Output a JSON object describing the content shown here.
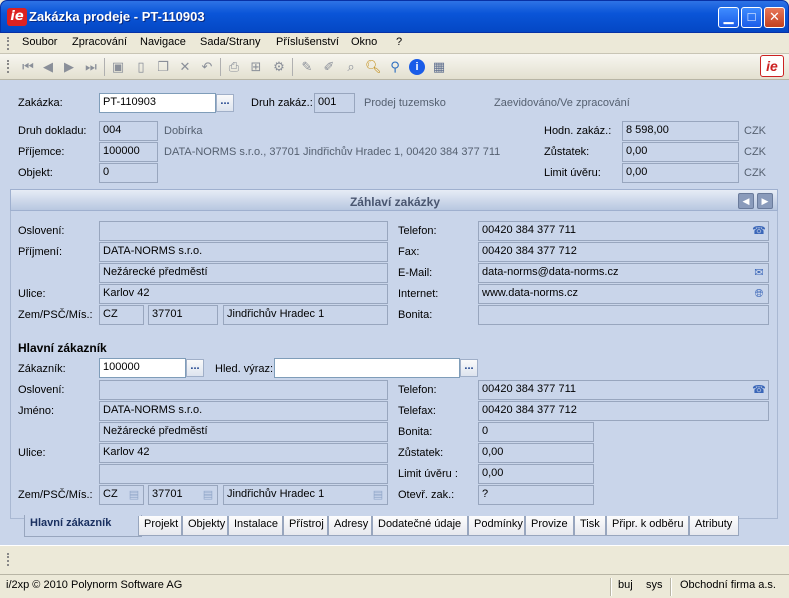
{
  "window": {
    "title": "Zakázka prodeje - PT-110903",
    "icon": "ie-app-icon",
    "buttons": [
      "minimize",
      "maximize",
      "close"
    ]
  },
  "menu": [
    "Soubor",
    "Zpracování",
    "Navigace",
    "Sada/Strany",
    "Příslušenství",
    "Okno",
    "?"
  ],
  "toolbar": {
    "icons": [
      "first-record-icon",
      "prev-record-icon",
      "next-record-icon",
      "last-record-icon",
      "save-icon",
      "new-icon",
      "copy-icon",
      "delete-icon",
      "undo-icon",
      "print-icon",
      "tree-icon",
      "settings-icon",
      "edit-icon",
      "edit2-icon",
      "find-icon",
      "search-icon",
      "zoom-icon",
      "info-icon",
      "calculator-icon"
    ],
    "logo": "ie"
  },
  "header": {
    "zakazka_label": "Zakázka:",
    "zakazka_value": "PT-110903",
    "druh_zakaz_label": "Druh zakáz.:",
    "druh_zakaz_value": "001",
    "druh_zakaz_text": "Prodej tuzemsko",
    "status_text": "Zaevidováno/Ve zpracování",
    "druh_dokladu_label": "Druh dokladu:",
    "druh_dokladu_value": "004",
    "druh_dokladu_text": "Dobírka",
    "prijemce_label": "Příjemce:",
    "prijemce_value": "100000",
    "prijemce_text": "DATA-NORMS s.r.o., 37701 Jindřichův Hradec 1, 00420 384 377 711",
    "objekt_label": "Objekt:",
    "objekt_value": "0",
    "hodn_label": "Hodn. zakáz.:",
    "hodn_value": "8 598,00",
    "hodn_currency": "CZK",
    "zustatek_label": "Zůstatek:",
    "zustatek_value": "0,00",
    "zustatek_currency": "CZK",
    "limit_label": "Limit úvěru:",
    "limit_value": "0,00",
    "limit_currency": "CZK"
  },
  "section": {
    "title": "Záhlaví zakázky"
  },
  "address": {
    "osloveni_label": "Oslovení:",
    "osloveni_value": "",
    "prijmeni_label": "Příjmení:",
    "prijmeni_value": "DATA-NORMS s.r.o.",
    "prijmeni_value2": "Nežárecké předměstí",
    "ulice_label": "Ulice:",
    "ulice_value": "Karlov 42",
    "zem_label": "Zem/PSČ/Mís.:",
    "zem_value": "CZ",
    "psc_value": "37701",
    "misto_value": "Jindřichův Hradec 1",
    "telefon_label": "Telefon:",
    "telefon_value": "00420 384 377 711",
    "fax_label": "Fax:",
    "fax_value": "00420 384 377 712",
    "email_label": "E-Mail:",
    "email_value": "data-norms@data-norms.cz",
    "internet_label": "Internet:",
    "internet_value": "www.data-norms.cz",
    "bonita_label": "Bonita:",
    "bonita_value": ""
  },
  "customer": {
    "heading": "Hlavní zákazník",
    "zakaznik_label": "Zákazník:",
    "zakaznik_value": "100000",
    "hled_label": "Hled. výraz:",
    "hled_value": "",
    "osloveni_label": "Oslovení:",
    "osloveni_value": "",
    "jmeno_label": "Jméno:",
    "jmeno_value": "DATA-NORMS s.r.o.",
    "jmeno_value2": "Nežárecké předměstí",
    "ulice_label": "Ulice:",
    "ulice_value": "Karlov 42",
    "ulice_value2": "",
    "zem_label": "Zem/PSČ/Mís.:",
    "zem_value": "CZ",
    "psc_value": "37701",
    "misto_value": "Jindřichův Hradec 1",
    "telefon_label": "Telefon:",
    "telefon_value": "00420 384 377 711",
    "telefax_label": "Telefax:",
    "telefax_value": "00420 384 377 712",
    "bonita_label": "Bonita:",
    "bonita_value": "0",
    "zustatek_label": "Zůstatek:",
    "zustatek_value": "0,00",
    "limit_label": "Limit úvěru :",
    "limit_value": "0,00",
    "otevr_label": "Otevř. zak.:",
    "otevr_value": "?"
  },
  "tabs": [
    "Hlavní zákazník",
    "Projekt",
    "Objekty",
    "Instalace",
    "Přístroj",
    "Adresy",
    "Dodatečné údaje",
    "Podmínky",
    "Provize",
    "Tisk",
    "Připr. k odběru",
    "Atributy"
  ],
  "status": {
    "copyright": "i/2xp © 2010 Polynorm Software AG",
    "user": "buj",
    "system": "sys",
    "company": "Obchodní firma a.s."
  },
  "colors": {
    "panel": "#C9D5EA",
    "title": "#0A55D8",
    "accent": "#1A3F8A"
  }
}
